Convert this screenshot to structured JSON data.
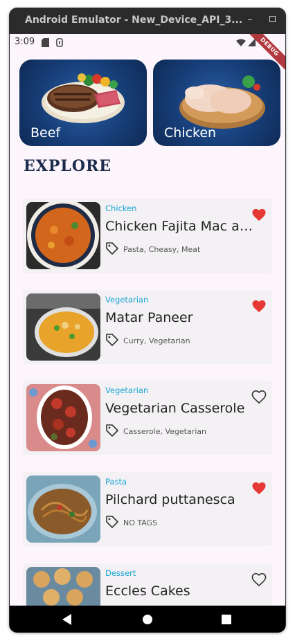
{
  "window": {
    "title": "Android Emulator - New_Device_API_3..."
  },
  "status_bar": {
    "time": "3:09"
  },
  "debug_banner": "DEBUG",
  "categories": [
    {
      "label": "Beef"
    },
    {
      "label": "Chicken"
    }
  ],
  "section_title": "EXPLORE",
  "recipes": [
    {
      "category": "Chicken",
      "name": "Chicken Fajita Mac and Cheese",
      "tags": "Pasta, Cheasy, Meat",
      "favorite": true
    },
    {
      "category": "Vegetarian",
      "name": "Matar Paneer",
      "tags": "Curry, Vegetarian",
      "favorite": true
    },
    {
      "category": "Vegetarian",
      "name": "Vegetarian Casserole",
      "tags": "Casserole, Vegetarian",
      "favorite": false
    },
    {
      "category": "Pasta",
      "name": "Pilchard puttanesca",
      "tags": "NO TAGS",
      "favorite": true
    },
    {
      "category": "Dessert",
      "name": "Eccles Cakes",
      "tags": "",
      "favorite": false
    }
  ],
  "colors": {
    "accent_category": "#1aa6d6",
    "heart_filled": "#e53935",
    "title": "#1d2c4b",
    "background": "#fcf5fb"
  },
  "icons": {
    "tag": "tag-icon",
    "favorite": "heart-icon",
    "back": "back-triangle-icon",
    "home": "home-circle-icon",
    "recents": "recents-square-icon"
  }
}
